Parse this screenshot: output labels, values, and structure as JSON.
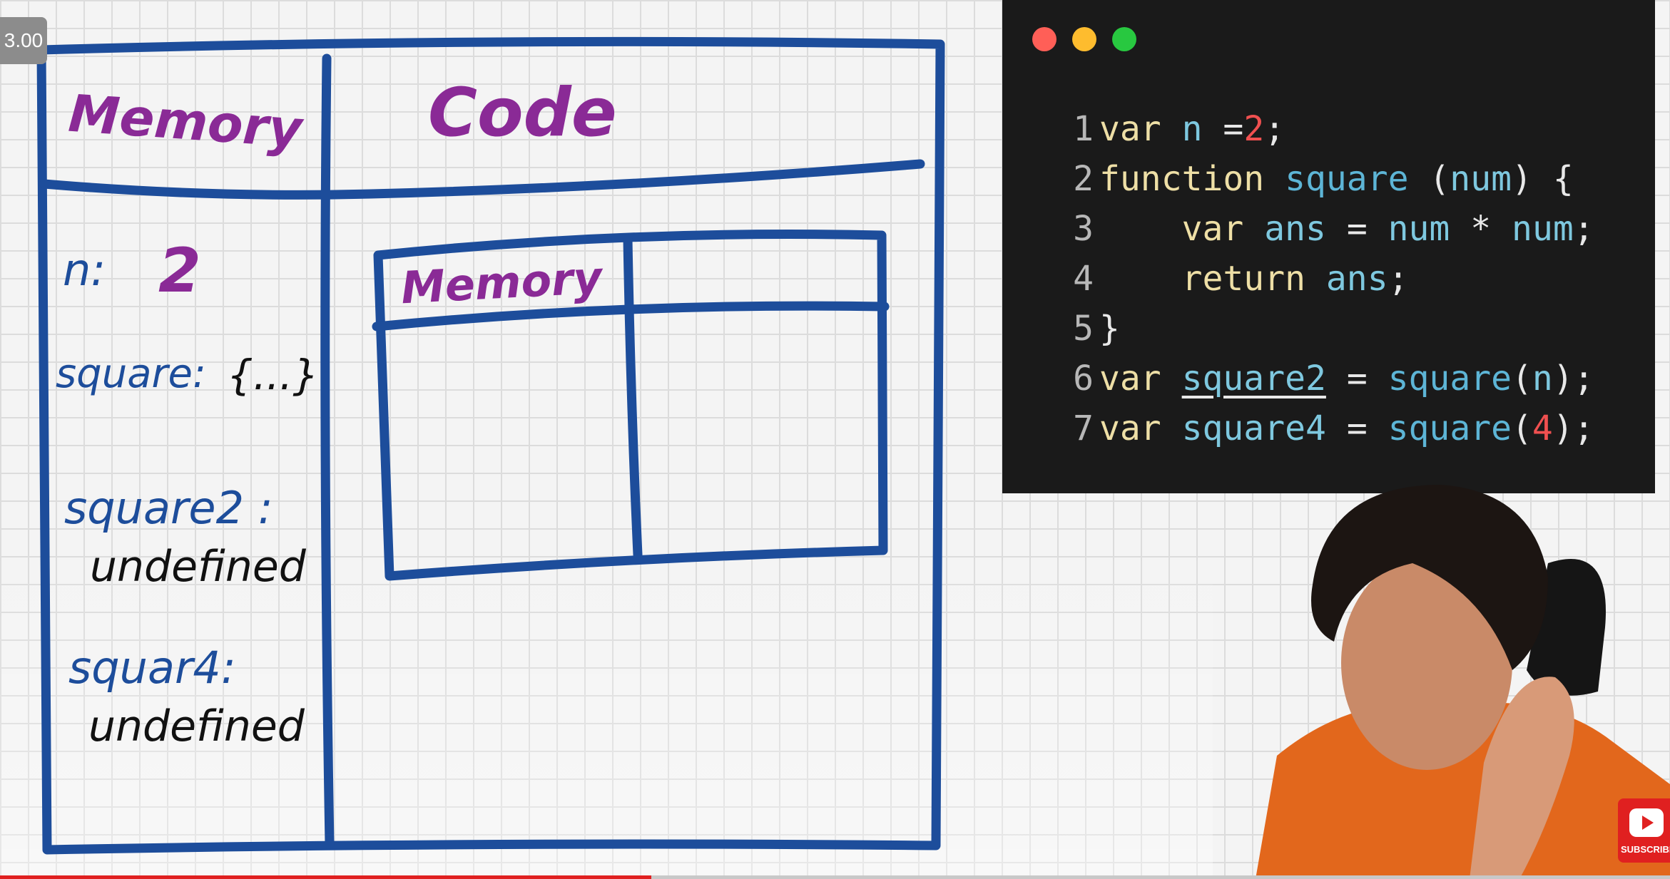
{
  "player": {
    "playback_speed": "3.00",
    "progress_fraction": 0.39,
    "subscribe_label": "SUBSCRIBE"
  },
  "whiteboard": {
    "header_memory": "Memory",
    "header_code": "Code",
    "memory_entries": [
      {
        "name": "n:",
        "value": "2"
      },
      {
        "name": "square:",
        "value": "{...}"
      },
      {
        "name": "square2 :",
        "value": "undefined"
      },
      {
        "name": "squar4:",
        "value": "undefined"
      }
    ],
    "inner_context": {
      "header_memory": "Memory"
    },
    "colors": {
      "outline": "#1d4d9b",
      "heading": "#8a2a96",
      "entry_name": "#1d4d9b",
      "entry_value": "#111111"
    }
  },
  "code_window": {
    "traffic_lights": [
      "#ff5f57",
      "#febc2e",
      "#28c840"
    ],
    "lines": [
      {
        "n": "1",
        "text": "var n =2;"
      },
      {
        "n": "2",
        "text": "function square (num) {"
      },
      {
        "n": "3",
        "text": "    var ans = num * num;"
      },
      {
        "n": "4",
        "text": "    return ans;"
      },
      {
        "n": "5",
        "text": "}"
      },
      {
        "n": "6",
        "text": "var square2 = square(n);"
      },
      {
        "n": "7",
        "text": "var square4 = square(4);"
      }
    ]
  }
}
